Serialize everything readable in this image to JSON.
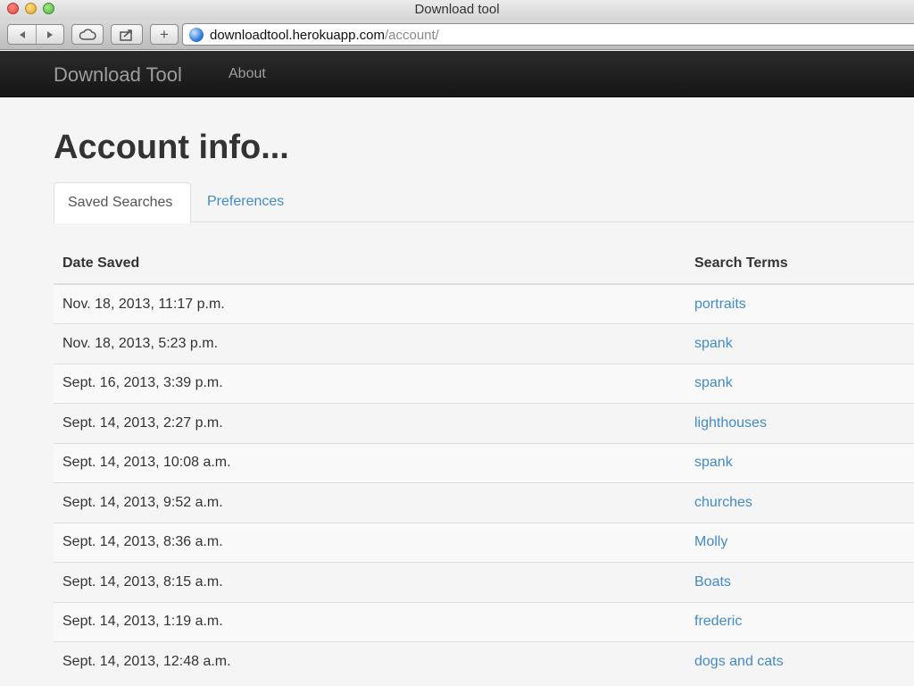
{
  "window": {
    "title": "Download tool"
  },
  "browser": {
    "url_host": "downloadtool.herokuapp.com",
    "url_path": "/account/"
  },
  "navbar": {
    "brand": "Download Tool",
    "links": [
      "About"
    ]
  },
  "page": {
    "title": "Account info..."
  },
  "tabs": [
    {
      "label": "Saved Searches",
      "active": true
    },
    {
      "label": "Preferences",
      "active": false
    }
  ],
  "table": {
    "headers": [
      "Date Saved",
      "Search Terms"
    ],
    "rows": [
      {
        "date": "Nov. 18, 2013, 11:17 p.m.",
        "term": "portraits"
      },
      {
        "date": "Nov. 18, 2013, 5:23 p.m.",
        "term": "spank"
      },
      {
        "date": "Sept. 16, 2013, 3:39 p.m.",
        "term": "spank"
      },
      {
        "date": "Sept. 14, 2013, 2:27 p.m.",
        "term": "lighthouses"
      },
      {
        "date": "Sept. 14, 2013, 10:08 a.m.",
        "term": "spank"
      },
      {
        "date": "Sept. 14, 2013, 9:52 a.m.",
        "term": "churches"
      },
      {
        "date": "Sept. 14, 2013, 8:36 a.m.",
        "term": "Molly"
      },
      {
        "date": "Sept. 14, 2013, 8:15 a.m.",
        "term": "Boats"
      },
      {
        "date": "Sept. 14, 2013, 1:19 a.m.",
        "term": "frederic"
      },
      {
        "date": "Sept. 14, 2013, 12:48 a.m.",
        "term": "dogs and cats"
      }
    ]
  },
  "colors": {
    "link": "#428bca",
    "navbar_bg": "#222222",
    "page_bg": "#f5f5f5"
  }
}
